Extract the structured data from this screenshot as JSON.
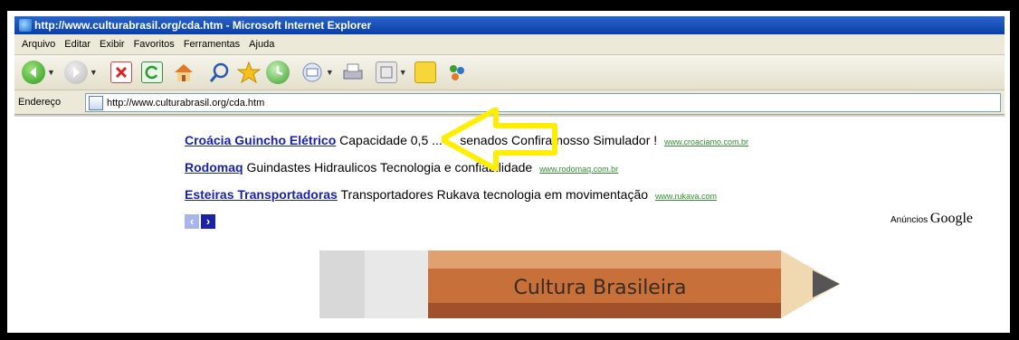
{
  "window": {
    "title": "http://www.culturabrasil.org/cda.htm - Microsoft Internet Explorer"
  },
  "menu": [
    "Arquivo",
    "Editar",
    "Exibir",
    "Favoritos",
    "Ferramentas",
    "Ajuda"
  ],
  "toolbar": {
    "icons": [
      "back-icon",
      "forward-icon",
      "stop-icon",
      "refresh-icon",
      "home-icon",
      "search-icon",
      "favorites-icon",
      "history-icon",
      "mail-icon",
      "print-icon",
      "edit-icon",
      "messenger-icon",
      "discuss-icon"
    ]
  },
  "address": {
    "label": "Endereço",
    "url": "http://www.culturabrasil.org/cda.htm"
  },
  "ads": [
    {
      "title": "Croácia Guincho Elétrico",
      "text": "Capacidade 0,5 ... ... senados Confira nosso Simulador !",
      "url": "www.croaciamo.com.br"
    },
    {
      "title": "Rodomaq",
      "text": "Guindastes Hidraulicos Tecnologia e confiabilidade",
      "url": "www.rodomaq.com.br"
    },
    {
      "title": "Esteiras Transportadoras",
      "text": "Transportadores Rukava tecnologia em movimentação",
      "url": "www.rukava.com"
    }
  ],
  "ads_label": {
    "prefix": "Anúncios",
    "brand": "Google"
  },
  "banner": {
    "text": "Cultura Brasileira"
  },
  "colors": {
    "arrow": "#ffee00",
    "link": "#1a22a8",
    "title_bar": "#0a3fa6"
  }
}
